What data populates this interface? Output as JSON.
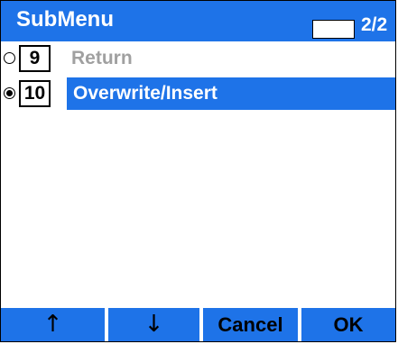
{
  "header": {
    "title": "SubMenu",
    "page_indicator": "2/2"
  },
  "menu": {
    "items": [
      {
        "number": "9",
        "label": "Return",
        "state": "disabled",
        "radio": "off"
      },
      {
        "number": "10",
        "label": "Overwrite/Insert",
        "state": "selected",
        "radio": "on"
      }
    ]
  },
  "softkeys": {
    "up": "↑",
    "down": "↓",
    "cancel": "Cancel",
    "ok": "OK"
  },
  "colors": {
    "accent": "#1e73e8",
    "disabled_text": "#a0a0a0",
    "selected_text": "#ffffff"
  },
  "icons": {
    "up": "arrow-up-icon",
    "down": "arrow-down-icon",
    "radio_off": "radio-off-icon",
    "radio_on": "radio-on-icon"
  }
}
